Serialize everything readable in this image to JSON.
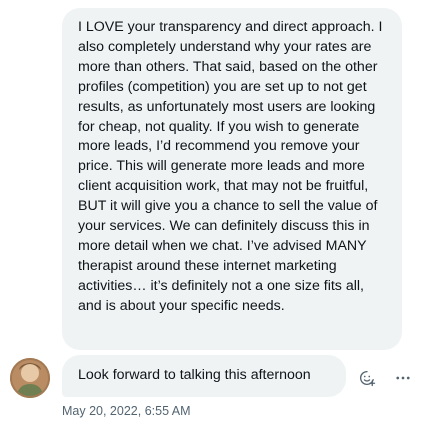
{
  "messages": [
    {
      "text": "I LOVE your transparency and direct approach. I also completely understand why your rates are more than others. That said, based on the other profiles (competition) you are set up to not get results, as unfortunately most users are looking for cheap, not quality. If you wish to generate more leads, I’d recommend you remove your price. This will generate more leads and more client acquisition work, that may not be fruitful, BUT it will give you a chance to sell the value of your services. We can definitely discuss this in more detail when we chat. I’ve advised MANY therapist around these internet marketing activities… it’s definitely not a one size fits all, and is about your specific needs."
    },
    {
      "text": "Look forward to talking this afternoon",
      "timestamp": "May 20, 2022, 6:55 AM"
    }
  ],
  "icons": {
    "avatar": "avatar",
    "react": "add-reaction-icon",
    "more": "more-horizontal-icon"
  },
  "colors": {
    "bubble": "#eff3f4",
    "text": "#0f1419",
    "muted": "#536471"
  }
}
